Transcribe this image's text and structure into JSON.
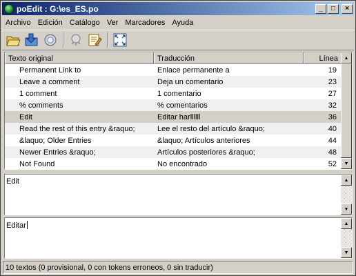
{
  "window": {
    "title": "poEdit : G:\\es_ES.po",
    "minimize": "_",
    "maximize": "□",
    "close": "×"
  },
  "menubar": {
    "items": [
      {
        "label": "Archivo"
      },
      {
        "label": "Edición"
      },
      {
        "label": "Catálogo"
      },
      {
        "label": "Ver"
      },
      {
        "label": "Marcadores"
      },
      {
        "label": "Ayuda"
      }
    ]
  },
  "toolbar": {
    "icons": [
      "open-folder-icon",
      "save-icon",
      "update-catalog-icon",
      "validate-icon",
      "comment-icon",
      "fullscreen-icon"
    ]
  },
  "list": {
    "headers": {
      "original": "Texto original",
      "translation": "Traducción",
      "line": "Línea"
    },
    "rows": [
      {
        "original": "Permanent Link to",
        "translation": "Enlace permanente a",
        "line": "19"
      },
      {
        "original": "Leave a comment",
        "translation": "Deja un comentario",
        "line": "23"
      },
      {
        "original": "1 comment",
        "translation": "1 comentario",
        "line": "27"
      },
      {
        "original": "% comments",
        "translation": "% comentarios",
        "line": "32"
      },
      {
        "original": "Edit",
        "translation": "Editar harllllll",
        "line": "36"
      },
      {
        "original": "Read the rest of this entry &raquo;",
        "translation": "Lee el resto del artículo &raquo;",
        "line": "40"
      },
      {
        "original": "&laquo; Older Entries",
        "translation": "&laquo; Artículos anteriores",
        "line": "44"
      },
      {
        "original": "Newer Entries &raquo;",
        "translation": "Artículos posteriores &raquo;",
        "line": "48"
      },
      {
        "original": "Not Found",
        "translation": "No encontrado",
        "line": "52"
      }
    ],
    "selected_index": 4
  },
  "source_pane": {
    "text": "Edit"
  },
  "translation_pane": {
    "text": "Editar"
  },
  "statusbar": {
    "text": "10 textos (0 provisional, 0 con tokens erroneos, 0 sin traducir)"
  }
}
